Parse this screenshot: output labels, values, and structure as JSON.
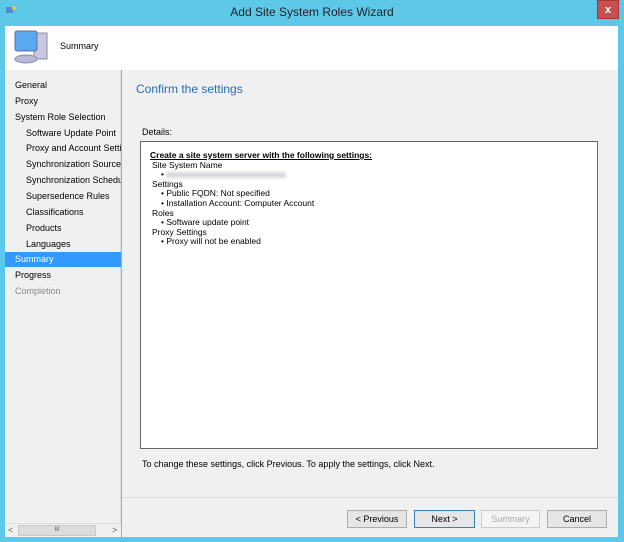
{
  "window": {
    "title": "Add Site System Roles Wizard",
    "close": "x"
  },
  "header": {
    "page": "Summary"
  },
  "nav": [
    {
      "label": "General",
      "level": 0,
      "state": "normal"
    },
    {
      "label": "Proxy",
      "level": 0,
      "state": "normal"
    },
    {
      "label": "System Role Selection",
      "level": 0,
      "state": "normal"
    },
    {
      "label": "Software Update Point",
      "level": 1,
      "state": "normal"
    },
    {
      "label": "Proxy and Account Settings",
      "level": 1,
      "state": "normal"
    },
    {
      "label": "Synchronization Source",
      "level": 1,
      "state": "normal"
    },
    {
      "label": "Synchronization Schedule",
      "level": 1,
      "state": "normal"
    },
    {
      "label": "Supersedence Rules",
      "level": 1,
      "state": "normal"
    },
    {
      "label": "Classifications",
      "level": 1,
      "state": "normal"
    },
    {
      "label": "Products",
      "level": 1,
      "state": "normal"
    },
    {
      "label": "Languages",
      "level": 1,
      "state": "normal"
    },
    {
      "label": "Summary",
      "level": 0,
      "state": "selected"
    },
    {
      "label": "Progress",
      "level": 0,
      "state": "normal"
    },
    {
      "label": "Completion",
      "level": 0,
      "state": "disabled"
    }
  ],
  "main": {
    "title": "Confirm the settings",
    "details_label": "Details:",
    "details": {
      "heading": "Create a site system server with the following settings:",
      "l1": "Site System Name",
      "l3": "Settings",
      "l4": "• Public FQDN: Not specified",
      "l5": "• Installation Account: Computer Account",
      "l6": "Roles",
      "l7": "• Software update point",
      "l8": "Proxy Settings",
      "l9": "• Proxy will not be enabled"
    },
    "footer": "To change these settings, click Previous. To apply the settings, click Next."
  },
  "buttons": {
    "previous": "< Previous",
    "next": "Next >",
    "summary": "Summary",
    "cancel": "Cancel"
  },
  "scrollbar": {
    "left": "<",
    "thumb": "III",
    "right": ">"
  }
}
